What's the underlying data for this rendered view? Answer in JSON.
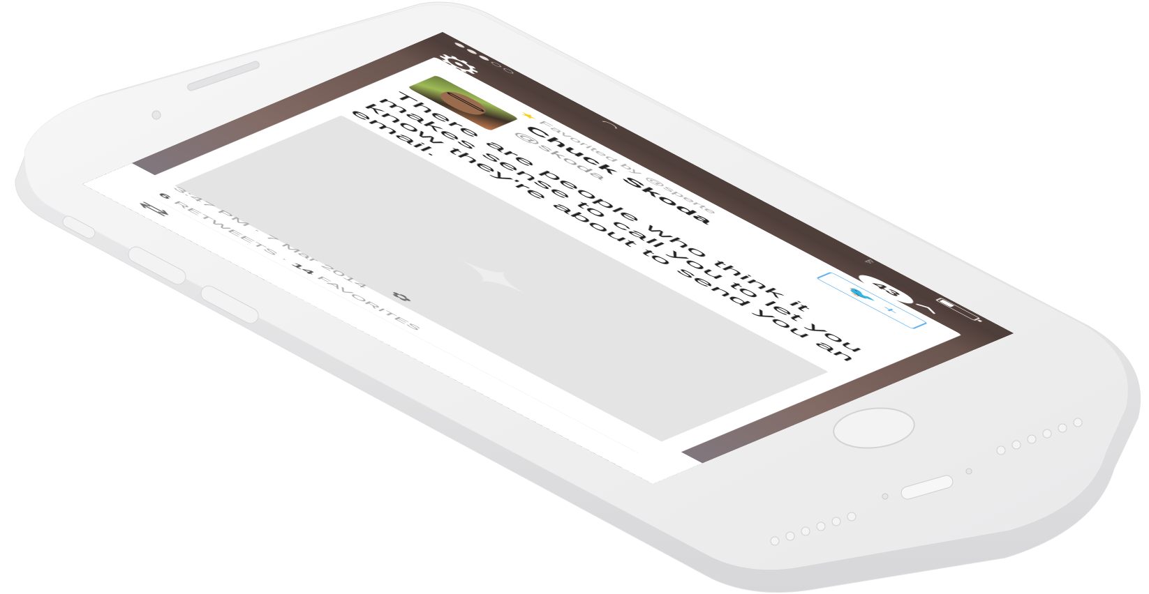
{
  "status_bar": {
    "signal_dots": [
      true,
      true,
      true,
      false,
      false
    ],
    "wifi_icon": "wifi-icon",
    "bluetooth_icon": "bluetooth-icon",
    "battery_level": 0.35
  },
  "header": {
    "settings_icon": "gear-icon",
    "unread_count": "43",
    "collapse_icon": "chevron-icon"
  },
  "tweet": {
    "favorited_by": "Favorited by @sperte",
    "author_name": "Chuck Skoda",
    "author_handle": "@skoda",
    "follow_button_label": "+",
    "text": "There are people who think it makes sense to call you to let you know they're about to send you an email.",
    "media_placeholder_icon": "bird-icon",
    "more_label": "•••"
  },
  "detail": {
    "time": "3:47 PM",
    "date_separator": "·",
    "date": "7 Mar 2014",
    "retweet_count": "6",
    "retweet_label": "RETWEETS",
    "stats_separator": "·",
    "favorite_count": "14",
    "favorite_label": "FAVORITES"
  },
  "colors": {
    "header_brown": "#4e3f3b",
    "twitter_blue": "#55acee",
    "favorite_yellow": "#f5cf15"
  }
}
